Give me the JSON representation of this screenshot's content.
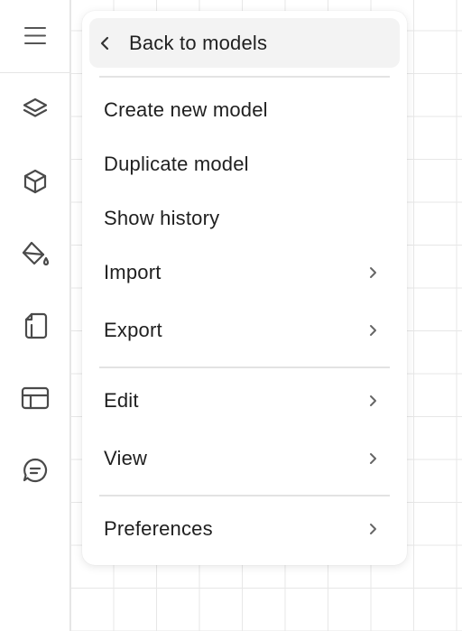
{
  "sidebar": {
    "icons": [
      "menu-icon",
      "layers-icon",
      "cube-icon",
      "paint-bucket-icon",
      "pages-icon",
      "table-icon",
      "chat-icon"
    ]
  },
  "menu": {
    "back_label": "Back to models",
    "group1": [
      {
        "label": "Create new model"
      },
      {
        "label": "Duplicate model"
      },
      {
        "label": "Show history"
      },
      {
        "label": "Import"
      },
      {
        "label": "Export"
      }
    ],
    "group2": [
      {
        "label": "Edit"
      },
      {
        "label": "View"
      }
    ],
    "group3": [
      {
        "label": "Preferences"
      }
    ]
  },
  "colors": {
    "text": "#1f1f1f",
    "icon": "#4a4a4a",
    "hover_bg": "#f3f3f3",
    "divider": "#e3e3e3"
  }
}
